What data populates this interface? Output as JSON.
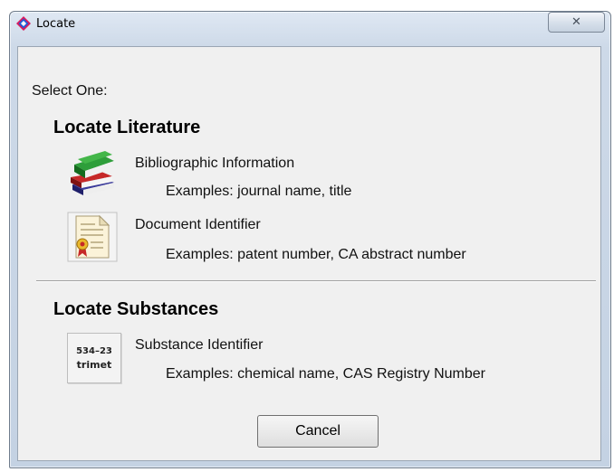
{
  "window": {
    "title": "Locate",
    "close_glyph": "✕"
  },
  "prompt": "Select One:",
  "literature": {
    "heading": "Locate Literature",
    "options": [
      {
        "label": "Bibliographic Information",
        "examples": "Examples: journal name, title",
        "icon": "books-icon"
      },
      {
        "label": "Document Identifier",
        "examples": "Examples: patent number, CA abstract number",
        "icon": "certificate-document-icon"
      }
    ]
  },
  "substances": {
    "heading": "Locate Substances",
    "options": [
      {
        "label": "Substance Identifier",
        "examples": "Examples: chemical name, CAS Registry Number",
        "icon": "substance-id-icon",
        "icon_line1": "534–23",
        "icon_line2": "trimet"
      }
    ]
  },
  "buttons": {
    "cancel": "Cancel"
  },
  "colors": {
    "frame": "#cdd9e8",
    "client": "#f0f0f0"
  }
}
